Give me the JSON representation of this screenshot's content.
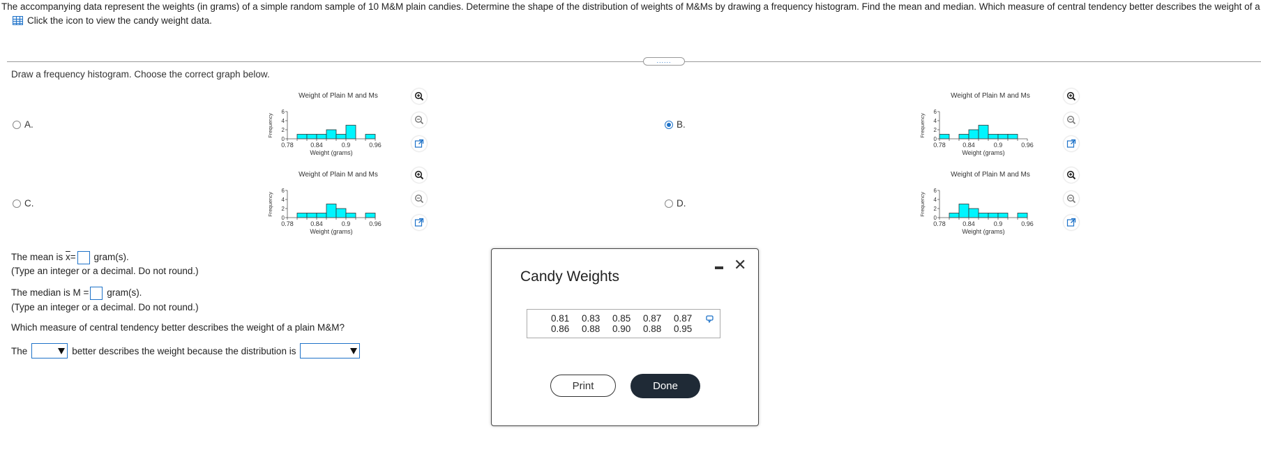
{
  "question": {
    "text": "The accompanying data represent the weights (in grams) of a simple random sample of 10 M&M plain candies. Determine the shape of the distribution of weights of M&Ms by drawing a frequency histogram. Find the mean and median. Which measure of central tendency better describes the weight of a plain M&",
    "data_link": "Click the icon to view the candy weight data.",
    "data_icon": "grid-table-icon"
  },
  "handle_label": "......",
  "instruction": "Draw a frequency histogram. Choose the correct graph below.",
  "options": [
    {
      "label": "A.",
      "selected": false
    },
    {
      "label": "B.",
      "selected": true
    },
    {
      "label": "C.",
      "selected": false
    },
    {
      "label": "D.",
      "selected": false
    }
  ],
  "chart_data": [
    {
      "type": "bar",
      "option": "A",
      "title": "Weight of Plain M and Ms",
      "xlabel": "Weight (grams)",
      "ylabel": "Frequency",
      "bin_edges": [
        0.78,
        0.8,
        0.82,
        0.84,
        0.86,
        0.88,
        0.9,
        0.92,
        0.94,
        0.96
      ],
      "values": [
        0,
        1,
        1,
        1,
        2,
        1,
        3,
        0,
        1
      ],
      "xticks": [
        "0.78",
        "0.84",
        "0.9",
        "0.96"
      ],
      "yticks": [
        "0",
        "2",
        "4",
        "6"
      ],
      "ylim": [
        0,
        6
      ],
      "bar_color": "#00f5ff"
    },
    {
      "type": "bar",
      "option": "B",
      "title": "Weight of Plain M and Ms",
      "xlabel": "Weight (grams)",
      "ylabel": "Frequency",
      "bin_edges": [
        0.78,
        0.8,
        0.82,
        0.84,
        0.86,
        0.88,
        0.9,
        0.92,
        0.94,
        0.96
      ],
      "values": [
        1,
        0,
        1,
        2,
        3,
        1,
        1,
        1,
        0
      ],
      "xticks": [
        "0.78",
        "0.84",
        "0.9",
        "0.96"
      ],
      "yticks": [
        "0",
        "2",
        "4",
        "6"
      ],
      "ylim": [
        0,
        6
      ],
      "bar_color": "#00f5ff"
    },
    {
      "type": "bar",
      "option": "C",
      "title": "Weight of Plain M and Ms",
      "xlabel": "Weight (grams)",
      "ylabel": "Frequency",
      "bin_edges": [
        0.78,
        0.8,
        0.82,
        0.84,
        0.86,
        0.88,
        0.9,
        0.92,
        0.94,
        0.96
      ],
      "values": [
        0,
        1,
        1,
        1,
        3,
        2,
        1,
        0,
        1
      ],
      "xticks": [
        "0.78",
        "0.84",
        "0.9",
        "0.96"
      ],
      "yticks": [
        "0",
        "2",
        "4",
        "6"
      ],
      "ylim": [
        0,
        6
      ],
      "bar_color": "#00f5ff"
    },
    {
      "type": "bar",
      "option": "D",
      "title": "Weight of Plain M and Ms",
      "xlabel": "Weight (grams)",
      "ylabel": "Frequency",
      "bin_edges": [
        0.78,
        0.8,
        0.82,
        0.84,
        0.86,
        0.88,
        0.9,
        0.92,
        0.94,
        0.96
      ],
      "values": [
        0,
        1,
        3,
        2,
        1,
        1,
        1,
        0,
        1
      ],
      "xticks": [
        "0.78",
        "0.84",
        "0.9",
        "0.96"
      ],
      "yticks": [
        "0",
        "2",
        "4",
        "6"
      ],
      "ylim": [
        0,
        6
      ],
      "bar_color": "#00f5ff"
    }
  ],
  "zoom_icons": [
    "zoom-in-icon",
    "zoom-out-icon",
    "open-new-window-icon"
  ],
  "mean": {
    "prefix": "The mean is ",
    "symbol": "x",
    "eq": "=",
    "suffix": "gram(s).",
    "hint": "(Type an integer or a decimal. Do not round.)"
  },
  "median": {
    "prefix": "The median is M =",
    "suffix": "gram(s).",
    "hint": "(Type an integer or a decimal. Do not round.)"
  },
  "which": "Which measure of central tendency better describes the weight of a plain M&M?",
  "sentence": {
    "start": "The",
    "middle": "better describes the weight because the distribution is"
  },
  "dialog": {
    "title": "Candy Weights",
    "values": [
      [
        "0.81",
        "0.83",
        "0.85",
        "0.87",
        "0.87"
      ],
      [
        "0.86",
        "0.88",
        "0.90",
        "0.88",
        "0.95"
      ]
    ],
    "copy_icon": "copy-icon",
    "print": "Print",
    "done": "Done"
  },
  "colors": {
    "accent": "#1e72c8",
    "bar": "#00f5ff",
    "done_bg": "#1f2a36"
  }
}
